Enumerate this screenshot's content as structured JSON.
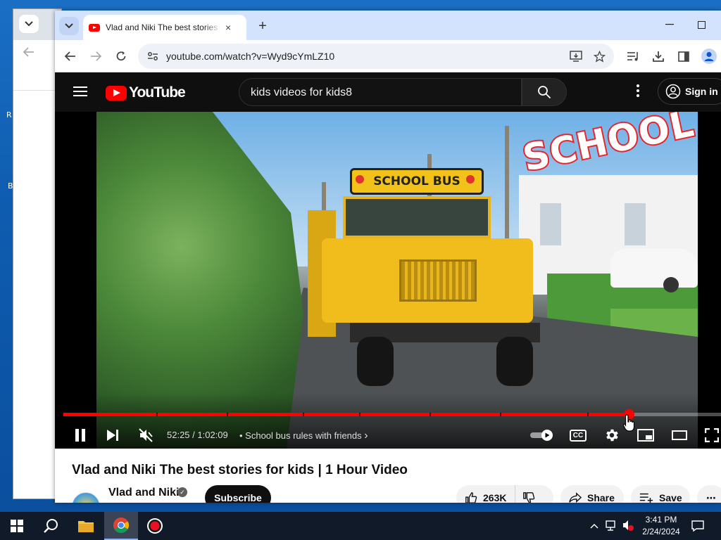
{
  "desktop": {
    "letters": [
      "R",
      "B"
    ]
  },
  "browser": {
    "tab": {
      "title": "Vlad and Niki The best stories f",
      "close": "×"
    },
    "new_tab": "+",
    "window": {
      "minimize": "—",
      "maximize": "☐"
    },
    "url": "youtube.com/watch?v=Wyd9cYmLZ10"
  },
  "youtube": {
    "logo_text": "YouTube",
    "search_query": "kids videos for kids8",
    "sign_in": "Sign in",
    "overlay_text": "SCHOOL",
    "bus_sign": "SCHOOL BUS",
    "player": {
      "time": "52:25 / 1:02:09",
      "chapter": "• School bus rules with friends",
      "chapter_arrow": "›",
      "progress": 0.8595,
      "cc": "CC"
    },
    "video_title": "Vlad and Niki The best stories for kids | 1 Hour Video",
    "channel_name": "Vlad and Niki",
    "verified": "✓",
    "subscribe": "Subscribe",
    "likes": "263K",
    "share": "Share",
    "save": "Save",
    "more": "⋯"
  },
  "taskbar": {
    "time": "3:41 PM",
    "date": "2/24/2024",
    "tray_chevron": "^"
  }
}
